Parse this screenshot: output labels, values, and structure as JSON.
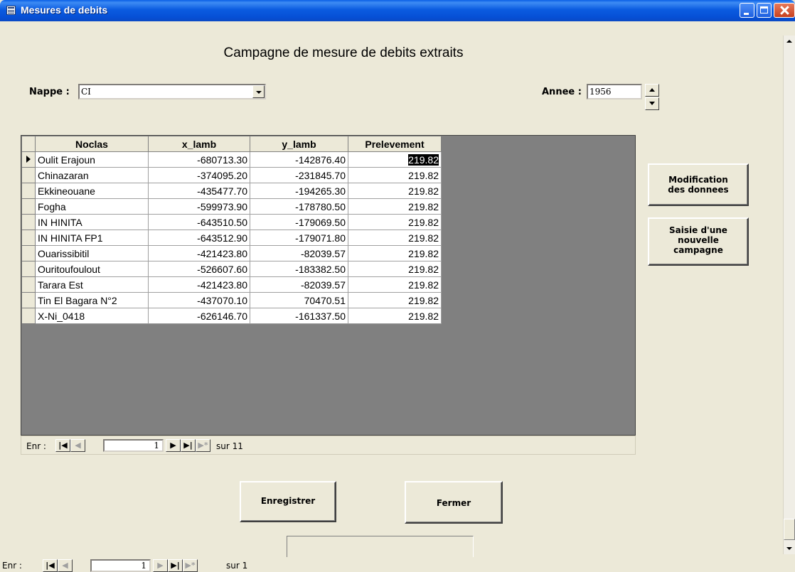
{
  "window": {
    "title": "Mesures de debits"
  },
  "form": {
    "title": "Campagne de mesure de debits extraits",
    "nappe_label": "Nappe :",
    "nappe_value": "CI",
    "annee_label": "Annee :",
    "annee_value": "1956"
  },
  "grid": {
    "columns": [
      "Noclas",
      "x_lamb",
      "y_lamb",
      "Prelevement"
    ],
    "rows": [
      [
        "Oulit Erajoun",
        "-680713.30",
        "-142876.40",
        "219.82"
      ],
      [
        "Chinazaran",
        "-374095.20",
        "-231845.70",
        "219.82"
      ],
      [
        "Ekkineouane",
        "-435477.70",
        "-194265.30",
        "219.82"
      ],
      [
        "Fogha",
        "-599973.90",
        "-178780.50",
        "219.82"
      ],
      [
        "IN HINITA",
        "-643510.50",
        "-179069.50",
        "219.82"
      ],
      [
        "IN HINITA FP1",
        "-643512.90",
        "-179071.80",
        "219.82"
      ],
      [
        "Ouarissibitil",
        "-421423.80",
        "-82039.57",
        "219.82"
      ],
      [
        "Ouritoufoulout",
        "-526607.60",
        "-183382.50",
        "219.82"
      ],
      [
        "Tarara Est",
        "-421423.80",
        "-82039.57",
        "219.82"
      ],
      [
        "Tin El Bagara N°2",
        "-437070.10",
        "70470.51",
        "219.82"
      ],
      [
        "X-Ni_0418",
        "-626146.70",
        "-161337.50",
        "219.82"
      ]
    ],
    "nav": {
      "label": "Enr :",
      "current": "1",
      "total_text": "sur 11"
    }
  },
  "buttons": {
    "modification": [
      "Modification",
      "des donnees"
    ],
    "saisie": [
      "Saisie d'une",
      "nouvelle",
      "campagne"
    ],
    "enregistrer": "Enregistrer",
    "fermer": "Fermer"
  },
  "form_nav": {
    "label": "Enr :",
    "current": "1",
    "total_text": "sur 1"
  }
}
